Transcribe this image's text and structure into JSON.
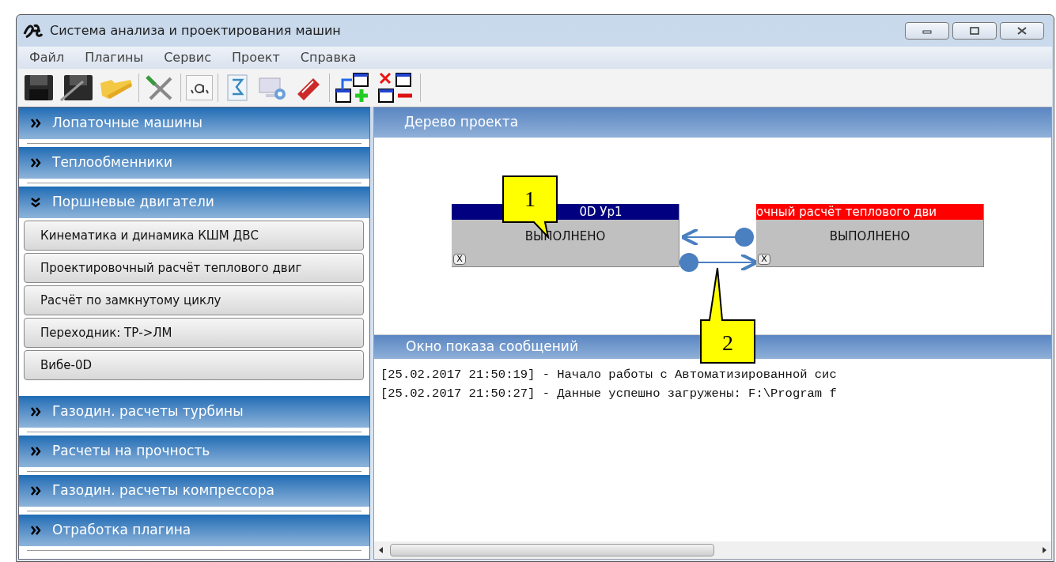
{
  "window": {
    "title": "Система анализа и проектирования машин"
  },
  "menu": [
    "Файл",
    "Плагины",
    "Сервис",
    "Проект",
    "Справка"
  ],
  "sidebar": {
    "groups": [
      {
        "label": "Лопаточные машины",
        "expanded": false
      },
      {
        "label": "Теплообменники",
        "expanded": false
      },
      {
        "label": "Поршневые двигатели",
        "expanded": true,
        "items": [
          "Кинематика и динамика КШМ ДВС",
          "Проектировочный расчёт теплового двиг",
          "Расчёт по замкнутому циклу",
          "Переходник: ТР->ЛМ",
          "Вибе-0D"
        ]
      },
      {
        "label": "Газодин. расчеты турбины",
        "expanded": false
      },
      {
        "label": "Расчеты на прочность",
        "expanded": false
      },
      {
        "label": "Газодин. расчеты компрессора",
        "expanded": false
      },
      {
        "label": "Отработка плагина",
        "expanded": false
      }
    ]
  },
  "project_tree": {
    "title": "Дерево проекта",
    "nodes": [
      {
        "title": "0D Ур1",
        "status": "ВЫПОЛНЕНО",
        "color": "#000080",
        "close": "X"
      },
      {
        "title": "очный расчёт теплового дви",
        "status": "ВЫПОЛНЕНО",
        "color": "#ff0000",
        "close": "X"
      }
    ]
  },
  "callouts": [
    "1",
    "2"
  ],
  "messages": {
    "title": "Окно показа сообщений",
    "lines": [
      "[25.02.2017 21:50:19] - Начало работы с Автоматизированной сис",
      "[25.02.2017 21:50:27] - Данные успешно загружены: F:\\Program f"
    ]
  }
}
